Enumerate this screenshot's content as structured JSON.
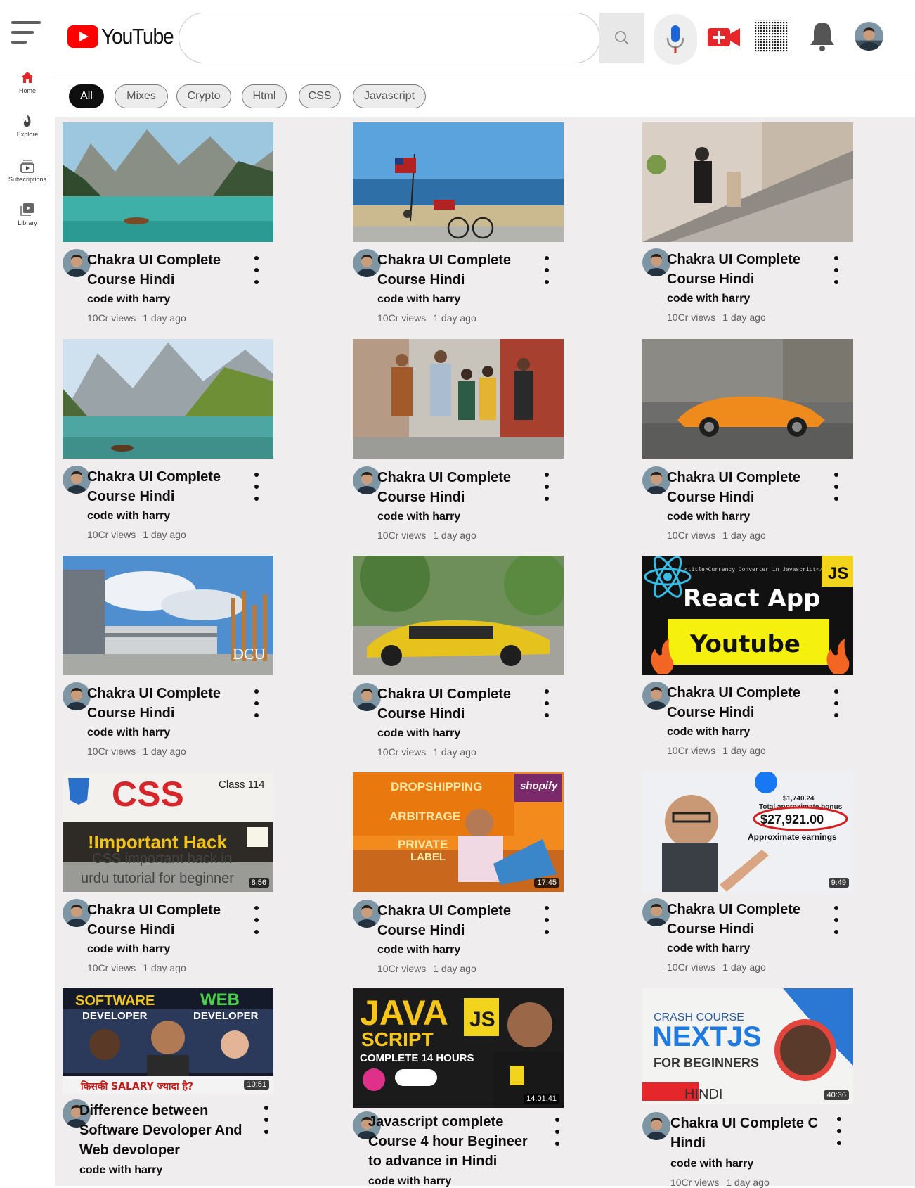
{
  "header": {
    "logo_text": "YouTube",
    "search_placeholder": "",
    "search_value": "",
    "icons": [
      "menu-icon",
      "search-icon",
      "microphone-icon",
      "video-camera-add-icon",
      "apps-grid-icon",
      "bell-icon"
    ],
    "colors": {
      "brand_red": "#ff0000",
      "mic_blue": "#1a66d9",
      "bell_gray": "#555555"
    }
  },
  "sidebar": {
    "items": [
      {
        "label": "Home",
        "icon": "home-icon",
        "active": true
      },
      {
        "label": "Explore",
        "icon": "explore-icon"
      },
      {
        "label": "Subscriptions",
        "icon": "subscriptions-icon"
      },
      {
        "label": "Library",
        "icon": "library-icon"
      }
    ]
  },
  "chips": [
    "All",
    "Mixes",
    "Crypto",
    "Html",
    "CSS",
    "Javascript"
  ],
  "videos": [
    {
      "title": "Chakra UI Complete Course Hindi",
      "channel": "code with harry",
      "views": "10Cr views",
      "age": "1 day ago",
      "thumb": "mountain-lake"
    },
    {
      "title": "Chakra UI Complete Course Hindi",
      "channel": "code with harry",
      "views": "10Cr views",
      "age": "1 day ago",
      "thumb": "beach-flag"
    },
    {
      "title": "Chakra UI Complete Course Hindi",
      "channel": "code with harry",
      "views": "10Cr views",
      "age": "1 day ago",
      "thumb": "escalator"
    },
    {
      "title": "Chakra UI Complete Course Hindi",
      "channel": "code with harry",
      "views": "10Cr views",
      "age": "1 day ago",
      "thumb": "alpine-lake"
    },
    {
      "title": "Chakra UI Complete Course Hindi",
      "channel": "code with harry",
      "views": "10Cr views",
      "age": "1 day ago",
      "thumb": "friends-walking"
    },
    {
      "title": "Chakra UI Complete Course Hindi",
      "channel": "code with harry",
      "views": "10Cr views",
      "age": "1 day ago",
      "thumb": "orange-car"
    },
    {
      "title": "Chakra UI Complete Course Hindi",
      "channel": "code with harry",
      "views": "10Cr views",
      "age": "1 day ago",
      "thumb": "campus",
      "thumb_text": "DCU"
    },
    {
      "title": "Chakra UI Complete Course Hindi",
      "channel": "code with harry",
      "views": "10Cr views",
      "age": "1 day ago",
      "thumb": "yellow-car"
    },
    {
      "title": "Chakra UI Complete Course Hindi",
      "channel": "code with harry",
      "views": "10Cr views",
      "age": "1 day ago",
      "thumb": "react-app",
      "thumb_text": "React App",
      "thumb_text2": "Youtube",
      "thumb_badge": "JS",
      "thumb_code": "<title>Currency Converter in Javascript</title>"
    },
    {
      "title": "Chakra UI Complete Course Hindi",
      "channel": "code with harry",
      "views": "10Cr views",
      "age": "1 day ago",
      "thumb": "css-hack",
      "thumb_text": "CSS",
      "thumb_text2": "!Important Hack",
      "thumb_text3": "CSS important hack in",
      "thumb_text4": "urdu tutorial for beginner",
      "thumb_badge": "Class 114",
      "duration": "8:56"
    },
    {
      "title": "Chakra UI Complete Course Hindi",
      "channel": "code with harry",
      "views": "10Cr views",
      "age": "1 day ago",
      "thumb": "dropshipping",
      "thumb_text": "DROPSHIPPING",
      "thumb_text2": "ARBITRAGE",
      "thumb_text3": "PRIVATE",
      "thumb_text4": "LABEL",
      "thumb_badge": "shopify",
      "duration": "17:45"
    },
    {
      "title": "Chakra UI Complete Course Hindi",
      "channel": "code with harry",
      "views": "10Cr views",
      "age": "1 day ago",
      "thumb": "earnings",
      "thumb_text": "$27,921.00",
      "thumb_text2": "Approximate earnings",
      "thumb_text3": "$1,740.24",
      "thumb_text4": "Total approximate bonus",
      "duration": "9:49"
    },
    {
      "title": "Difference between Software Devoloper And Web devoloper",
      "channel": "code with harry",
      "views": "",
      "age": "",
      "thumb": "software-web",
      "thumb_text": "SOFTWARE",
      "thumb_text2": "WEB",
      "thumb_text3": "DEVELOPER",
      "thumb_text4": "DEVELOPER",
      "thumb_badge": "किसकी SALARY ज्यादा है?",
      "duration": "10:51"
    },
    {
      "title": "Javascript complete Course 4 hour Begineer to advance in Hindi",
      "channel": "code with harry",
      "views": "",
      "age": "",
      "thumb": "javascript",
      "thumb_text": "JAVA",
      "thumb_text2": "SCRIPT",
      "thumb_text3": "COMPLETE 14 HOURS",
      "thumb_badge": "JS",
      "duration": "14:01:41"
    },
    {
      "title": "Chakra UI Complete C Hindi",
      "channel": "code with harry",
      "views": "10Cr views",
      "age": "1 day ago",
      "thumb": "nextjs",
      "thumb_text": "CRASH COURSE",
      "thumb_text2": "NEXTJS",
      "thumb_text3": "FOR BEGINNERS",
      "thumb_text4": "HINDI",
      "duration": "40:36"
    }
  ]
}
